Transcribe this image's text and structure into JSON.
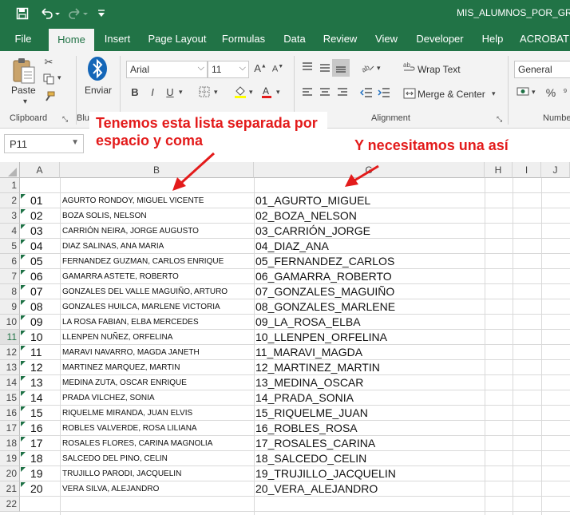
{
  "title_bar": {
    "document_title": "MIS_ALUMNOS_POR_GRUPO",
    "save_icon": "save-icon",
    "undo_icon": "undo-icon",
    "redo_icon": "redo-icon",
    "customize_icon": "customize-quick-access-icon"
  },
  "tabs": [
    "File",
    "Home",
    "Insert",
    "Page Layout",
    "Formulas",
    "Data",
    "Review",
    "View",
    "Developer",
    "Help",
    "ACROBAT"
  ],
  "active_tab": "Home",
  "ribbon": {
    "paste_label": "Paste",
    "enviar_label": "Enviar",
    "font_name": "Arial",
    "font_size": "11",
    "bold": "B",
    "italic": "I",
    "underline": "U",
    "wrap_text": "Wrap Text",
    "merge_center": "Merge & Center",
    "number_format": "General",
    "percent": "%",
    "groups": {
      "clipboard": "Clipboard",
      "bluetooth": "Blue",
      "alignment": "Alignment",
      "number": "Numbe"
    }
  },
  "name_box": "P11",
  "formula_dots": "⋮",
  "callouts": {
    "left": "Tenemos esta lista separada por espacio y coma",
    "right": "Y necesitamos una así"
  },
  "columns": [
    "A",
    "B",
    "G",
    "H",
    "I",
    "J"
  ],
  "rows": [
    {
      "n": "1",
      "a": "",
      "b": "",
      "g": ""
    },
    {
      "n": "2",
      "a": "01",
      "b": "AGURTO RONDOY, MIGUEL VICENTE",
      "g": "01_AGURTO_MIGUEL"
    },
    {
      "n": "3",
      "a": "02",
      "b": "BOZA SOLIS, NELSON",
      "g": "02_BOZA_NELSON"
    },
    {
      "n": "4",
      "a": "03",
      "b": "CARRIÓN NEIRA, JORGE AUGUSTO",
      "g": "03_CARRIÓN_JORGE"
    },
    {
      "n": "5",
      "a": "04",
      "b": "DIAZ SALINAS, ANA MARIA",
      "g": "04_DIAZ_ANA"
    },
    {
      "n": "6",
      "a": "05",
      "b": "FERNANDEZ GUZMAN, CARLOS ENRIQUE",
      "g": "05_FERNANDEZ_CARLOS"
    },
    {
      "n": "7",
      "a": "06",
      "b": "GAMARRA ASTETE, ROBERTO",
      "g": "06_GAMARRA_ROBERTO"
    },
    {
      "n": "8",
      "a": "07",
      "b": "GONZALES DEL VALLE MAGUIÑO, ARTURO",
      "g": "07_GONZALES_MAGUIÑO"
    },
    {
      "n": "9",
      "a": "08",
      "b": "GONZALES HUILCA, MARLENE VICTORIA",
      "g": "08_GONZALES_MARLENE"
    },
    {
      "n": "10",
      "a": "09",
      "b": "LA ROSA FABIAN, ELBA MERCEDES",
      "g": "09_LA_ROSA_ELBA"
    },
    {
      "n": "11",
      "a": "10",
      "b": "LLENPEN NUÑEZ, ORFELINA",
      "g": "10_LLENPEN_ORFELINA"
    },
    {
      "n": "12",
      "a": "11",
      "b": "MARAVI NAVARRO, MAGDA JANETH",
      "g": "11_MARAVI_MAGDA"
    },
    {
      "n": "13",
      "a": "12",
      "b": "MARTINEZ MARQUEZ, MARTIN",
      "g": "12_MARTINEZ_MARTIN"
    },
    {
      "n": "14",
      "a": "13",
      "b": "MEDINA ZUTA, OSCAR ENRIQUE",
      "g": "13_MEDINA_OSCAR"
    },
    {
      "n": "15",
      "a": "14",
      "b": "PRADA VILCHEZ, SONIA",
      "g": "14_PRADA_SONIA"
    },
    {
      "n": "16",
      "a": "15",
      "b": "RIQUELME MIRANDA, JUAN ELVIS",
      "g": "15_RIQUELME_JUAN"
    },
    {
      "n": "17",
      "a": "16",
      "b": "ROBLES VALVERDE, ROSA LILIANA",
      "g": "16_ROBLES_ROSA"
    },
    {
      "n": "18",
      "a": "17",
      "b": "ROSALES FLORES, CARINA MAGNOLIA",
      "g": "17_ROSALES_CARINA"
    },
    {
      "n": "19",
      "a": "18",
      "b": "SALCEDO DEL PINO, CELIN",
      "g": "18_SALCEDO_CELIN"
    },
    {
      "n": "20",
      "a": "19",
      "b": "TRUJILLO PARODI, JACQUELIN",
      "g": "19_TRUJILLO_JACQUELIN"
    },
    {
      "n": "21",
      "a": "20",
      "b": "VERA SILVA, ALEJANDRO",
      "g": "20_VERA_ALEJANDRO"
    },
    {
      "n": "22",
      "a": "",
      "b": "",
      "g": ""
    }
  ],
  "selected_row": "11",
  "colors": {
    "excel_green": "#217346",
    "callout_red": "#e31b1b",
    "text_number_indicator": "#1e7145"
  }
}
